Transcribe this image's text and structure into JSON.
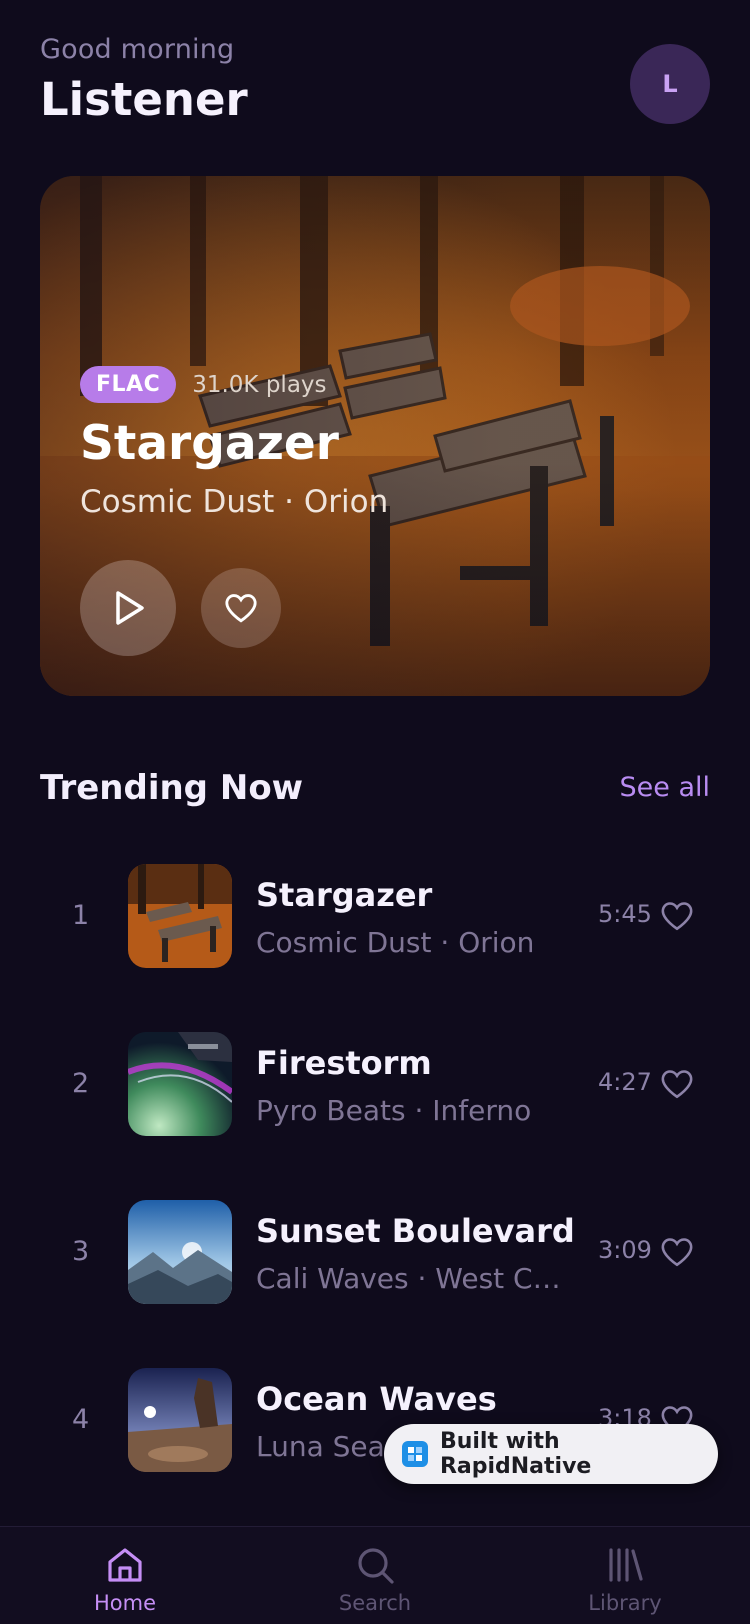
{
  "header": {
    "greeting": "Good morning",
    "username": "Listener",
    "avatar_initial": "L"
  },
  "featured": {
    "badge": "FLAC",
    "plays": "31.0K plays",
    "title": "Stargazer",
    "subtitle": "Cosmic Dust · Orion",
    "play_icon": "play-icon",
    "like_icon": "heart-icon"
  },
  "trending": {
    "title": "Trending Now",
    "see_all": "See all",
    "tracks": [
      {
        "rank": "1",
        "title": "Stargazer",
        "subtitle": "Cosmic Dust · Orion",
        "duration": "5:45"
      },
      {
        "rank": "2",
        "title": "Firestorm",
        "subtitle": "Pyro Beats · Inferno",
        "duration": "4:27"
      },
      {
        "rank": "3",
        "title": "Sunset Boulevard",
        "subtitle": "Cali Waves · West Coas...",
        "duration": "3:09"
      },
      {
        "rank": "4",
        "title": "Ocean Waves",
        "subtitle": "Luna Sea",
        "duration": "3:18"
      }
    ]
  },
  "toast": {
    "label": "Built with RapidNative"
  },
  "tabbar": {
    "tabs": [
      {
        "label": "Home",
        "icon": "home-icon",
        "active": true
      },
      {
        "label": "Search",
        "icon": "search-icon",
        "active": false
      },
      {
        "label": "Library",
        "icon": "library-icon",
        "active": false
      }
    ]
  },
  "colors": {
    "background": "#0f0b1c",
    "accent": "#b77ce9",
    "muted_text": "#8c82a8"
  }
}
